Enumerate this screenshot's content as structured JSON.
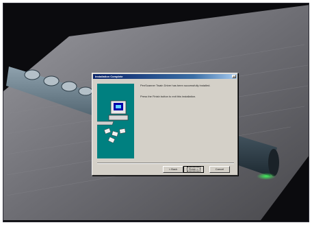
{
  "wizard": {
    "title": "Installation Complete",
    "close_glyph": "×",
    "message_line1": "PenScanner Twain Driver has been successfully installed.",
    "message_line2": "Press the Finish button to exit this installation.",
    "back_label": "< Back",
    "finish_label": "Finish >",
    "cancel_label": "Cancel"
  },
  "icons": {
    "side_art": "computer-install-icon",
    "close": "close-icon"
  },
  "colors": {
    "desktop_bg": "#0b0b0e",
    "dialog_face": "#d4d0c8",
    "titlebar_start": "#0a246a",
    "titlebar_end": "#a6caf0",
    "side_panel": "#008080",
    "scanner_led": "#3cff5a"
  }
}
